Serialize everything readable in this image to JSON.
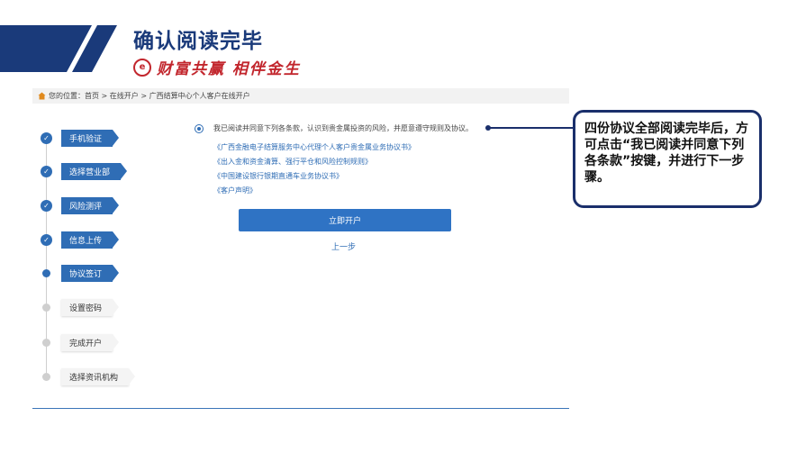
{
  "slide": {
    "title": "确认阅读完毕",
    "slogan_logo_text": "e",
    "slogan": "财富共赢 相伴金生",
    "accent_color": "#1a3a7a"
  },
  "breadcrumb": {
    "text": "您的位置：首页 > 在线开户 > 广西结算中心个人客户在线开户"
  },
  "steps": [
    {
      "label": "手机验证",
      "status": "done"
    },
    {
      "label": "选择营业部",
      "status": "done"
    },
    {
      "label": "风险测评",
      "status": "done"
    },
    {
      "label": "信息上传",
      "status": "done"
    },
    {
      "label": "协议签订",
      "status": "current"
    },
    {
      "label": "设置密码",
      "status": "pending"
    },
    {
      "label": "完成开户",
      "status": "pending"
    },
    {
      "label": "选择资讯机构",
      "status": "pending"
    }
  ],
  "agreement": {
    "check_glyph": "✓",
    "text": "我已阅读并同意下列各条款，认识到贵金属投资的风险，并愿意遵守规则及协议。",
    "documents": [
      "《广西金融电子结算服务中心代理个人客户贵金属业务协议书》",
      "《出入金和资金清算、强行平仓和风险控制规则》",
      "《中国建设银行银期直通车业务协议书》",
      "《客户声明》"
    ]
  },
  "actions": {
    "primary": "立即开户",
    "back": "上一步"
  },
  "callout": {
    "text": "四份协议全部阅读完毕后，方可点击“我已阅读并同意下列各条款”按键，并进行下一步骤。"
  },
  "colors": {
    "primary": "#2f73c4",
    "navy": "#1a2f6b",
    "slogan_red": "#c2262d"
  }
}
